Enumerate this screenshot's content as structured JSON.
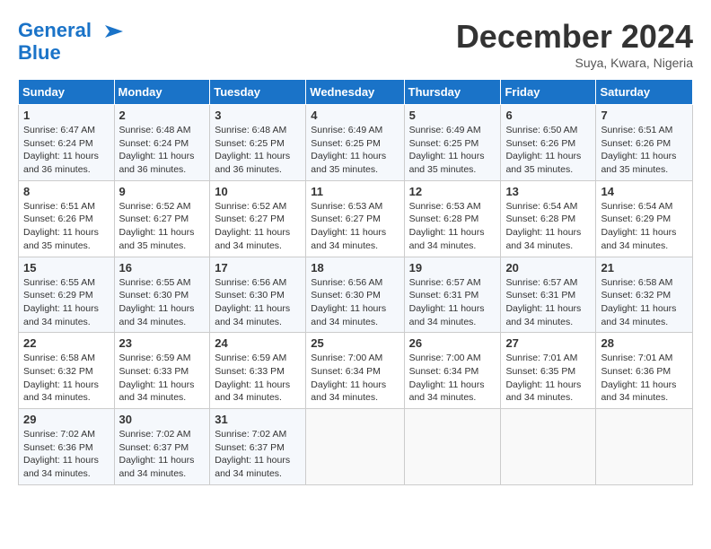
{
  "header": {
    "logo_line1": "General",
    "logo_line2": "Blue",
    "month_title": "December 2024",
    "subtitle": "Suya, Kwara, Nigeria"
  },
  "calendar": {
    "days_of_week": [
      "Sunday",
      "Monday",
      "Tuesday",
      "Wednesday",
      "Thursday",
      "Friday",
      "Saturday"
    ],
    "weeks": [
      [
        {
          "day": "",
          "info": ""
        },
        {
          "day": "2",
          "info": "Sunrise: 6:48 AM\nSunset: 6:24 PM\nDaylight: 11 hours\nand 36 minutes."
        },
        {
          "day": "3",
          "info": "Sunrise: 6:48 AM\nSunset: 6:25 PM\nDaylight: 11 hours\nand 36 minutes."
        },
        {
          "day": "4",
          "info": "Sunrise: 6:49 AM\nSunset: 6:25 PM\nDaylight: 11 hours\nand 35 minutes."
        },
        {
          "day": "5",
          "info": "Sunrise: 6:49 AM\nSunset: 6:25 PM\nDaylight: 11 hours\nand 35 minutes."
        },
        {
          "day": "6",
          "info": "Sunrise: 6:50 AM\nSunset: 6:26 PM\nDaylight: 11 hours\nand 35 minutes."
        },
        {
          "day": "7",
          "info": "Sunrise: 6:51 AM\nSunset: 6:26 PM\nDaylight: 11 hours\nand 35 minutes."
        }
      ],
      [
        {
          "day": "1",
          "info": "Sunrise: 6:47 AM\nSunset: 6:24 PM\nDaylight: 11 hours\nand 36 minutes."
        },
        {
          "day": "",
          "info": ""
        },
        {
          "day": "",
          "info": ""
        },
        {
          "day": "",
          "info": ""
        },
        {
          "day": "",
          "info": ""
        },
        {
          "day": "",
          "info": ""
        },
        {
          "day": ""
        }
      ],
      [
        {
          "day": "8",
          "info": "Sunrise: 6:51 AM\nSunset: 6:26 PM\nDaylight: 11 hours\nand 35 minutes."
        },
        {
          "day": "9",
          "info": "Sunrise: 6:52 AM\nSunset: 6:27 PM\nDaylight: 11 hours\nand 35 minutes."
        },
        {
          "day": "10",
          "info": "Sunrise: 6:52 AM\nSunset: 6:27 PM\nDaylight: 11 hours\nand 34 minutes."
        },
        {
          "day": "11",
          "info": "Sunrise: 6:53 AM\nSunset: 6:27 PM\nDaylight: 11 hours\nand 34 minutes."
        },
        {
          "day": "12",
          "info": "Sunrise: 6:53 AM\nSunset: 6:28 PM\nDaylight: 11 hours\nand 34 minutes."
        },
        {
          "day": "13",
          "info": "Sunrise: 6:54 AM\nSunset: 6:28 PM\nDaylight: 11 hours\nand 34 minutes."
        },
        {
          "day": "14",
          "info": "Sunrise: 6:54 AM\nSunset: 6:29 PM\nDaylight: 11 hours\nand 34 minutes."
        }
      ],
      [
        {
          "day": "15",
          "info": "Sunrise: 6:55 AM\nSunset: 6:29 PM\nDaylight: 11 hours\nand 34 minutes."
        },
        {
          "day": "16",
          "info": "Sunrise: 6:55 AM\nSunset: 6:30 PM\nDaylight: 11 hours\nand 34 minutes."
        },
        {
          "day": "17",
          "info": "Sunrise: 6:56 AM\nSunset: 6:30 PM\nDaylight: 11 hours\nand 34 minutes."
        },
        {
          "day": "18",
          "info": "Sunrise: 6:56 AM\nSunset: 6:30 PM\nDaylight: 11 hours\nand 34 minutes."
        },
        {
          "day": "19",
          "info": "Sunrise: 6:57 AM\nSunset: 6:31 PM\nDaylight: 11 hours\nand 34 minutes."
        },
        {
          "day": "20",
          "info": "Sunrise: 6:57 AM\nSunset: 6:31 PM\nDaylight: 11 hours\nand 34 minutes."
        },
        {
          "day": "21",
          "info": "Sunrise: 6:58 AM\nSunset: 6:32 PM\nDaylight: 11 hours\nand 34 minutes."
        }
      ],
      [
        {
          "day": "22",
          "info": "Sunrise: 6:58 AM\nSunset: 6:32 PM\nDaylight: 11 hours\nand 34 minutes."
        },
        {
          "day": "23",
          "info": "Sunrise: 6:59 AM\nSunset: 6:33 PM\nDaylight: 11 hours\nand 34 minutes."
        },
        {
          "day": "24",
          "info": "Sunrise: 6:59 AM\nSunset: 6:33 PM\nDaylight: 11 hours\nand 34 minutes."
        },
        {
          "day": "25",
          "info": "Sunrise: 7:00 AM\nSunset: 6:34 PM\nDaylight: 11 hours\nand 34 minutes."
        },
        {
          "day": "26",
          "info": "Sunrise: 7:00 AM\nSunset: 6:34 PM\nDaylight: 11 hours\nand 34 minutes."
        },
        {
          "day": "27",
          "info": "Sunrise: 7:01 AM\nSunset: 6:35 PM\nDaylight: 11 hours\nand 34 minutes."
        },
        {
          "day": "28",
          "info": "Sunrise: 7:01 AM\nSunset: 6:36 PM\nDaylight: 11 hours\nand 34 minutes."
        }
      ],
      [
        {
          "day": "29",
          "info": "Sunrise: 7:02 AM\nSunset: 6:36 PM\nDaylight: 11 hours\nand 34 minutes."
        },
        {
          "day": "30",
          "info": "Sunrise: 7:02 AM\nSunset: 6:37 PM\nDaylight: 11 hours\nand 34 minutes."
        },
        {
          "day": "31",
          "info": "Sunrise: 7:02 AM\nSunset: 6:37 PM\nDaylight: 11 hours\nand 34 minutes."
        },
        {
          "day": "",
          "info": ""
        },
        {
          "day": "",
          "info": ""
        },
        {
          "day": "",
          "info": ""
        },
        {
          "day": "",
          "info": ""
        }
      ]
    ]
  }
}
